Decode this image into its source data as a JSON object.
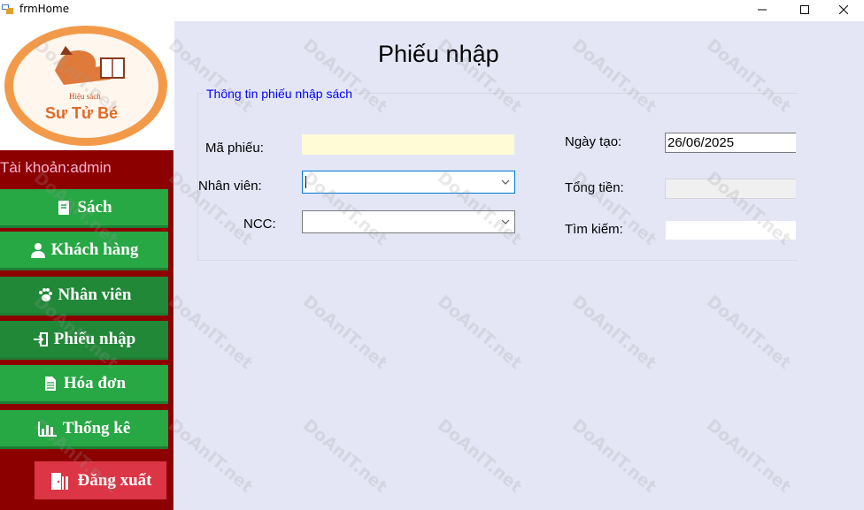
{
  "window": {
    "title": "frmHome"
  },
  "sidebar": {
    "logo_text_top": "Hiệu sách",
    "logo_text_main": "Sư Tử Bé",
    "account_label": "Tài khoản:admin",
    "items": [
      {
        "label": "Sách",
        "icon": "book-icon"
      },
      {
        "label": "Khách hàng",
        "icon": "user-icon"
      },
      {
        "label": "Nhân viên",
        "icon": "paw-icon"
      },
      {
        "label": "Phiếu nhập",
        "icon": "sign-in-icon"
      },
      {
        "label": "Hóa đơn",
        "icon": "file-icon"
      },
      {
        "label": "Thống kê",
        "icon": "chart-icon"
      }
    ],
    "logout_label": "Đăng xuất",
    "logout_icon": "door-exit-icon"
  },
  "main": {
    "title": "Phiếu nhập",
    "group_title": "Thông tin phiếu nhập sách",
    "fields": {
      "ma_phieu": {
        "label": "Mã phiếu:",
        "value": ""
      },
      "nhan_vien": {
        "label": "Nhân viên:",
        "value": ""
      },
      "ncc": {
        "label": "NCC:",
        "value": ""
      },
      "ngay_tao": {
        "label": "Ngày tạo:",
        "value": "26/06/2025"
      },
      "tong_tien": {
        "label": "Tổng tiền:",
        "value": ""
      },
      "tim_kiem": {
        "label": "Tìm kiếm:",
        "value": ""
      }
    }
  },
  "watermark": {
    "text": "DoAnIT.net"
  },
  "colors": {
    "sidebar_bg": "#8c0000",
    "nav_button": "#28a745",
    "logout_button": "#dc3545",
    "main_bg": "#e4e6f6",
    "group_title": "#0000ff",
    "ma_phieu_bg": "#fffbd6"
  }
}
